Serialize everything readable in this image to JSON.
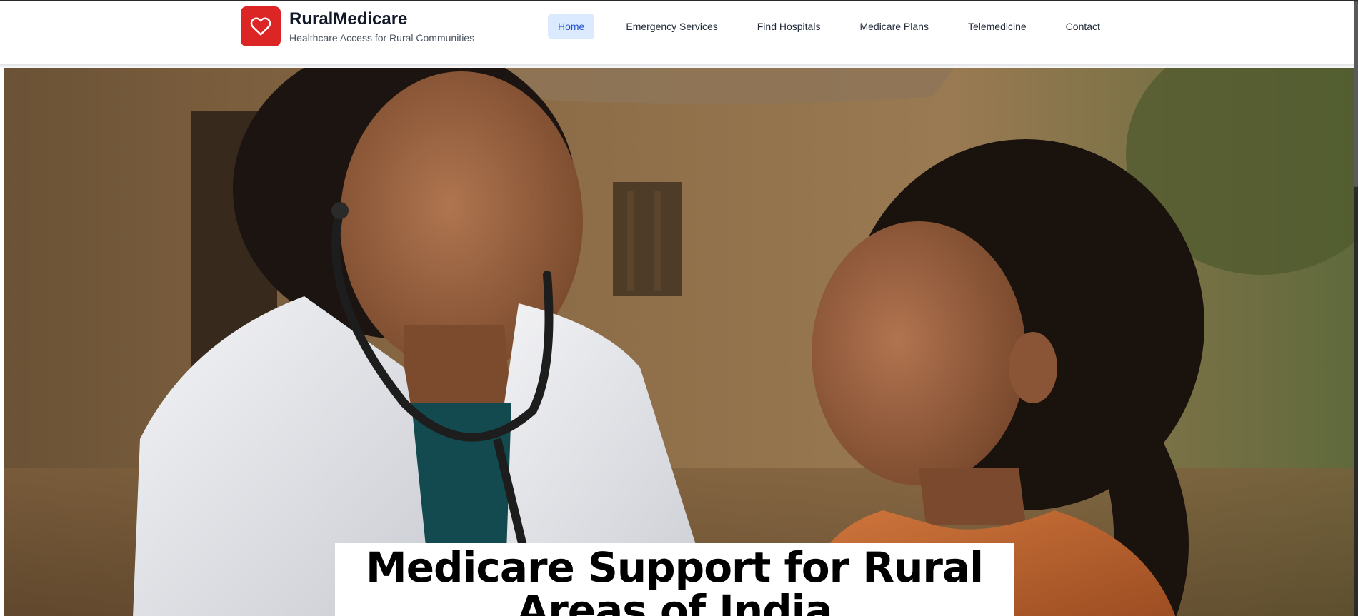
{
  "brand": {
    "name": "RuralMedicare",
    "tagline": "Healthcare Access for Rural Communities",
    "logo_icon": "heart-icon",
    "accent": "#dc2626"
  },
  "nav": {
    "items": [
      {
        "label": "Home",
        "active": true
      },
      {
        "label": "Emergency Services",
        "active": false
      },
      {
        "label": "Find Hospitals",
        "active": false
      },
      {
        "label": "Medicare Plans",
        "active": false
      },
      {
        "label": "Telemedicine",
        "active": false
      },
      {
        "label": "Contact",
        "active": false
      }
    ],
    "active_bg": "#dbeafe",
    "active_color": "#1d4ed8"
  },
  "hero": {
    "title": "Medicare Support for Rural Areas of India",
    "image": "doctor-examining-child-photo"
  }
}
